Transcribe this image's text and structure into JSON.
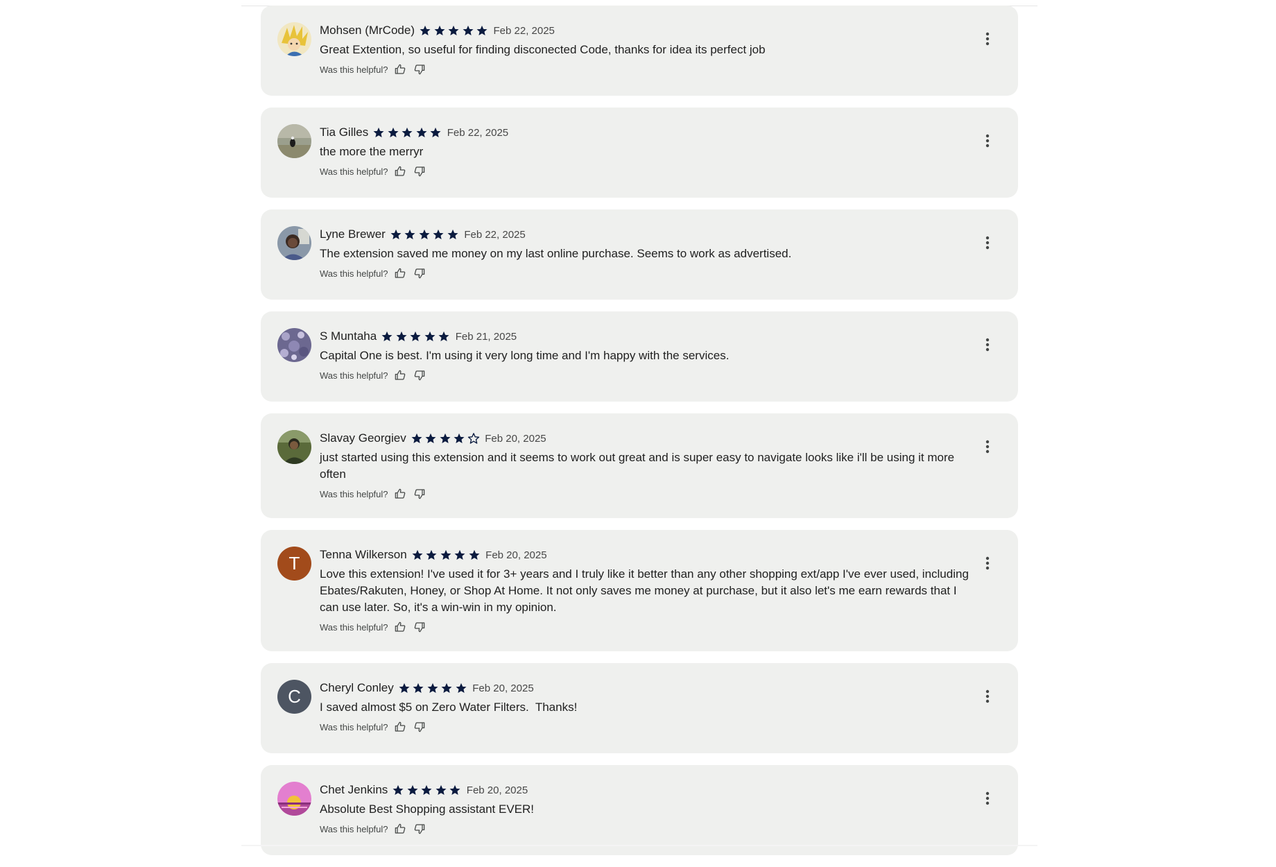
{
  "helpful_prompt": "Was this helpful?",
  "colors": {
    "card_bg": "#eff0ee",
    "star": "#0b1b3f",
    "avatar_t": "#a24b1b",
    "avatar_c": "#4d5562"
  },
  "reviews": [
    {
      "name": "Mohsen (MrCode)",
      "rating": 5,
      "date": "Feb 22, 2025",
      "text": "Great Extention, so useful for finding disconected Code, thanks for idea its perfect job",
      "avatar": {
        "type": "image",
        "icon": "cartoon-character-avatar"
      }
    },
    {
      "name": "Tia Gilles",
      "rating": 5,
      "date": "Feb 22, 2025",
      "text": "the more the merryr",
      "avatar": {
        "type": "image",
        "icon": "bird-photo-avatar"
      }
    },
    {
      "name": "Lyne Brewer",
      "rating": 5,
      "date": "Feb 22, 2025",
      "text": "The extension saved me money on my last online purchase. Seems to work as advertised.",
      "avatar": {
        "type": "image",
        "icon": "person-photo-avatar"
      }
    },
    {
      "name": "S Muntaha",
      "rating": 5,
      "date": "Feb 21, 2025",
      "text": "Capital One is best. I'm using it very long time and I'm happy with the services.",
      "avatar": {
        "type": "image",
        "icon": "floral-photo-avatar"
      }
    },
    {
      "name": "Slavay Georgiev",
      "rating": 4,
      "date": "Feb 20, 2025",
      "text": "just started using this extension and it seems to work out great and is super easy to navigate looks like i'll be using it more often",
      "avatar": {
        "type": "image",
        "icon": "person-outdoor-photo-avatar"
      }
    },
    {
      "name": "Tenna Wilkerson",
      "rating": 5,
      "date": "Feb 20, 2025",
      "text": "Love this extension! I've used it for 3+ years and I truly like it better than any other shopping ext/app I've ever used, including Ebates/Rakuten, Honey, or Shop At Home. It not only saves me money at purchase, but it also let's me earn rewards that I can use later. So, it's a win-win in my opinion.",
      "avatar": {
        "type": "letter",
        "letter": "T",
        "color": "#a24b1b"
      }
    },
    {
      "name": "Cheryl Conley",
      "rating": 5,
      "date": "Feb 20, 2025",
      "text": "I saved almost $5 on Zero Water Filters.  Thanks!",
      "avatar": {
        "type": "letter",
        "letter": "C",
        "color": "#4d5562"
      }
    },
    {
      "name": "Chet Jenkins",
      "rating": 5,
      "date": "Feb 20, 2025",
      "text": "Absolute Best Shopping assistant EVER!",
      "avatar": {
        "type": "image",
        "icon": "sunset-avatar"
      }
    }
  ]
}
